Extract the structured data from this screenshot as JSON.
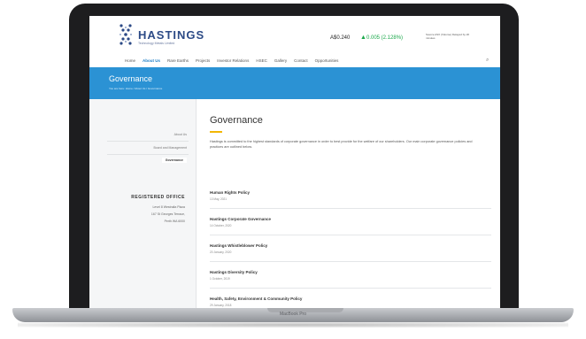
{
  "site": {
    "logo_name": "HASTINGS",
    "logo_tagline": "Technology Metals Limited"
  },
  "stock": {
    "price": "A$0.240",
    "arrow": "▲",
    "change": "0.005 (2.128%)",
    "note": "Source ASX (Volume) Delayed by 20 minutes"
  },
  "nav": {
    "items": [
      "Home",
      "About Us",
      "Rare Earths",
      "Projects",
      "Investor Relations",
      "HSEC",
      "Gallery",
      "Contact",
      "Opportunities"
    ],
    "active_index": 1,
    "search_glyph": "⌕"
  },
  "banner": {
    "title": "Governance",
    "breadcrumb": "You are here: Home / About Us / Governance"
  },
  "sidebar": {
    "items": [
      "About Us",
      "Board and Management",
      "Governance"
    ],
    "active_index": 2,
    "office_heading": "REGISTERED OFFICE",
    "office_lines": [
      "Level 8 Westralia Plaza",
      "167 St Georges Terrace,",
      "Perth WA 6000"
    ]
  },
  "main": {
    "title": "Governance",
    "intro": "Hastings is committed to the highest standards of corporate governance in order to best provide for the welfare of our shareholders. Our main corporate governance policies and practices are outlined below.",
    "policies": [
      {
        "title": "Human Rights Policy",
        "date": "13 May, 2021"
      },
      {
        "title": "Hastings Corporate Governance",
        "date": "14 October, 2020"
      },
      {
        "title": "Hastings Whistleblower Policy",
        "date": "20 January, 2020"
      },
      {
        "title": "Hastings Diversity Policy",
        "date": "1 October, 2019"
      },
      {
        "title": "Health, Safety, Environment & Community Policy",
        "date": "29 January, 2018"
      }
    ]
  },
  "device": {
    "label": "MacBook Pro"
  },
  "colors": {
    "brand_blue": "#2b92d4",
    "logo_navy": "#2c4a86",
    "accent_yellow": "#f2b705",
    "stock_up": "#1aa84a"
  }
}
